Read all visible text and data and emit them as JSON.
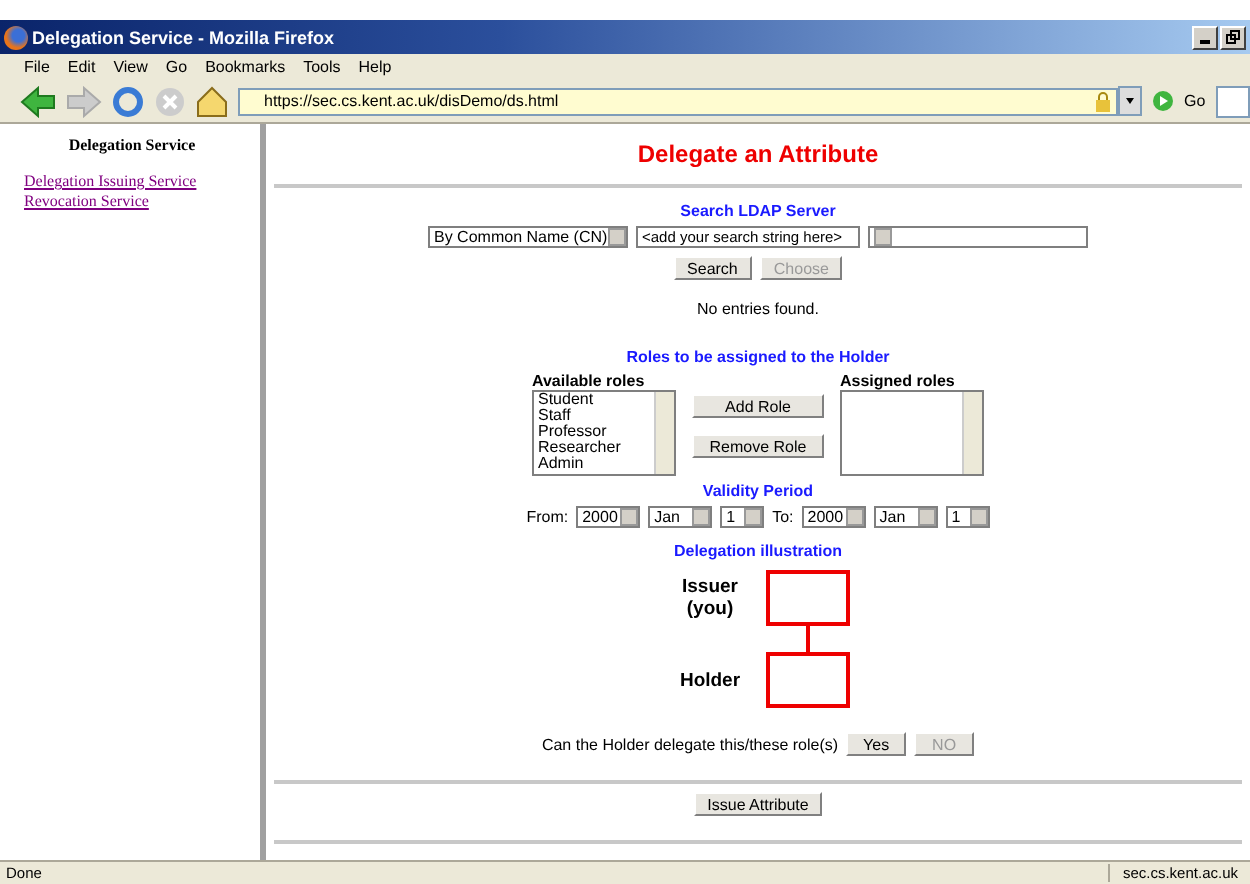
{
  "window": {
    "title": "Delegation Service - Mozilla Firefox"
  },
  "menu": [
    "File",
    "Edit",
    "View",
    "Go",
    "Bookmarks",
    "Tools",
    "Help"
  ],
  "address": {
    "url": "https://sec.cs.kent.ac.uk/disDemo/ds.html",
    "go": "Go"
  },
  "sidebar": {
    "heading": "Delegation Service",
    "links": [
      "Delegation Issuing Service",
      "Revocation Service"
    ]
  },
  "page_title": "Delegate an Attribute",
  "search": {
    "heading": "Search LDAP Server",
    "search_by": "By Common Name (CN)",
    "query": "<add your search string here>",
    "buttons": [
      {
        "label": "Search",
        "disabled": false
      },
      {
        "label": "Choose",
        "disabled": true
      }
    ],
    "message": "No entries found."
  },
  "roles": {
    "heading": "Roles to be assigned to the Holder",
    "available_label": "Available roles",
    "available": [
      "Student",
      "Staff",
      "Professor",
      "Researcher",
      "Admin"
    ],
    "assigned_label": "Assigned roles",
    "buttons": [
      "Add Role",
      "Remove Role"
    ]
  },
  "validity": {
    "heading": "Validity Period",
    "from_label": "From:",
    "from": [
      "2000",
      "Jan",
      "1"
    ],
    "to_label": "To:",
    "to": [
      "2000",
      "Jan",
      "1"
    ]
  },
  "illustration": {
    "heading": "Delegation illustration",
    "issuer": "Issuer",
    "issuer_note": "(you)",
    "holder": "Holder"
  },
  "delegate": {
    "question": "Can the Holder delegate this/these role(s)",
    "buttons": [
      {
        "label": "Yes",
        "disabled": false
      },
      {
        "label": "NO",
        "disabled": true
      }
    ]
  },
  "issue_button": "Issue Attribute",
  "status_bar": {
    "left": "Done",
    "right": "sec.cs.kent.ac.uk"
  }
}
